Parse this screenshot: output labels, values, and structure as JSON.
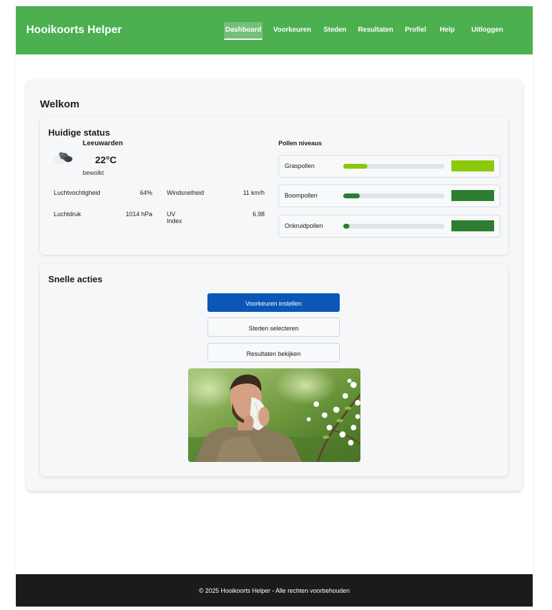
{
  "header": {
    "brand": "Hooikoorts Helper",
    "nav": [
      "Dashboard",
      "Voorkeuren",
      "Steden",
      "Resultaten",
      "Profiel",
      "Help",
      "Uitloggen"
    ],
    "active_nav": "Dashboard"
  },
  "welcome": {
    "title": "Welkom"
  },
  "status": {
    "title": "Huidige status",
    "weather_icon": "cloud-icon",
    "city": "Leeuwarden",
    "temperature": "22°C",
    "condition": "bewolkt",
    "metrics": [
      {
        "label": "Luchtvochtigheid",
        "value": "64%"
      },
      {
        "label": "Windsnelheid",
        "value": "11 km/h"
      },
      {
        "label": "Luchtdruk",
        "value": "1014 hPa"
      },
      {
        "label": "UV Index",
        "value": "6.98"
      }
    ]
  },
  "pollen": {
    "title": "Pollen niveaus",
    "items": [
      {
        "name": "Graspollen",
        "level": 0.24,
        "color": "#8bc90a"
      },
      {
        "name": "Boompollen",
        "level": 0.16,
        "color": "#2e7d32"
      },
      {
        "name": "Onkruidpollen",
        "level": 0.06,
        "color": "#2e7d32"
      }
    ]
  },
  "actions": {
    "title": "Snelle acties",
    "primary": "Voorkeuren instellen",
    "cities": "Steden selecteren",
    "results": "Resultaten bekijken"
  },
  "colors": {
    "header_bg": "#4caf50",
    "primary_button": "#0b57b8",
    "footer_bg": "#1b1b1b"
  },
  "footer": {
    "text": "© 2025 Hooikoorts Helper - Alle rechten voorbehouden"
  }
}
